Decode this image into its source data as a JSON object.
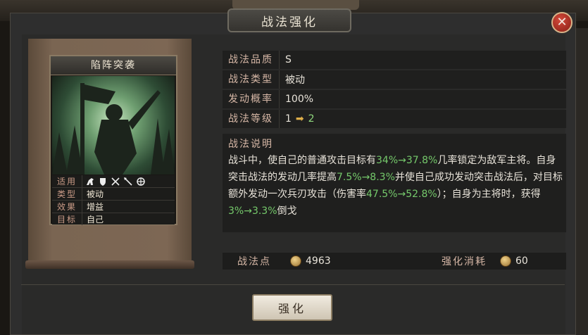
{
  "window": {
    "title": "战法强化",
    "close_label": "✕"
  },
  "card": {
    "name": "陷阵突袭",
    "attributes": [
      {
        "key": "适用",
        "value": ""
      },
      {
        "key": "类型",
        "value": "被动"
      },
      {
        "key": "效果",
        "value": "增益"
      },
      {
        "key": "目标",
        "value": "自己"
      }
    ],
    "troop_icons": [
      "cavalry-icon",
      "shield-icon",
      "bow-icon",
      "spear-icon",
      "siege-icon"
    ]
  },
  "info": {
    "quality": {
      "label": "战法品质",
      "value": "S"
    },
    "type": {
      "label": "战法类型",
      "value": "被动"
    },
    "rate": {
      "label": "发动概率",
      "value": "100%"
    },
    "level": {
      "label": "战法等级",
      "from": "1",
      "arrow": "➡",
      "to": "2"
    }
  },
  "description": {
    "title": "战法说明",
    "parts": [
      {
        "text": "战斗中，使自己的普通攻击目标有",
        "hl": false
      },
      {
        "text": "34%→37.8%",
        "hl": true
      },
      {
        "text": "几率锁定为敌军主将。自身突击战法的发动几率提高",
        "hl": false
      },
      {
        "text": "7.5%→8.3%",
        "hl": true
      },
      {
        "text": "并使自己成功发动突击战法后，对目标额外发动一次兵刃攻击（伤害率",
        "hl": false
      },
      {
        "text": "47.5%→52.8%",
        "hl": true
      },
      {
        "text": "）；自身为主将时，获得",
        "hl": false
      },
      {
        "text": "3%→3.3%",
        "hl": true
      },
      {
        "text": "倒戈",
        "hl": false
      }
    ]
  },
  "points": {
    "label": "战法点",
    "value": "4963",
    "cost_label": "强化消耗",
    "cost_value": "60"
  },
  "enhance_button": {
    "label": "强化"
  }
}
